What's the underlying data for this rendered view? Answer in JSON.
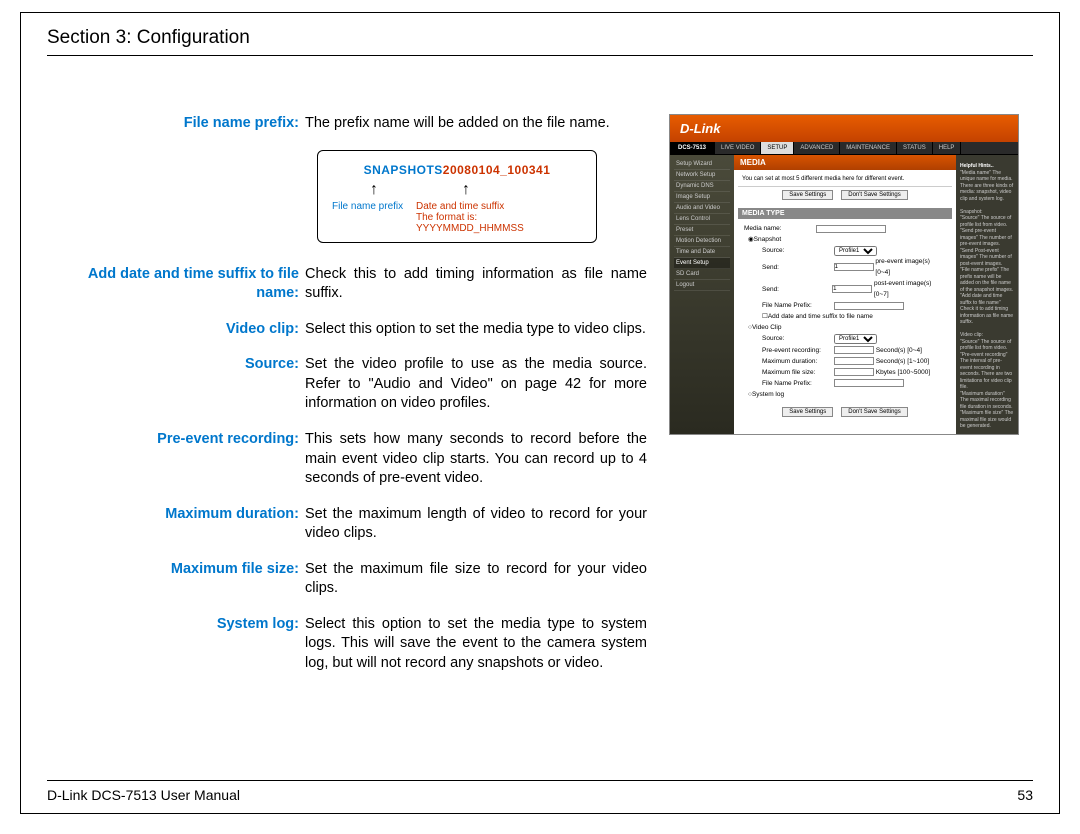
{
  "header": "Section 3: Configuration",
  "footer": {
    "left": "D-Link DCS-7513 User Manual",
    "right": "53"
  },
  "defs": {
    "file_name_prefix": {
      "term": "File name prefix:",
      "desc": "The prefix name will be added on the file name."
    },
    "add_datetime": {
      "term": "Add date and time suffix to file name:",
      "desc": "Check this to add timing information as file name suffix."
    },
    "video_clip": {
      "term": "Video clip:",
      "desc": "Select this option to set the media type to video clips."
    },
    "source": {
      "term": "Source:",
      "desc": "Set the video profile to use as the media source. Refer to \"Audio and Video\" on page 42 for more information on video profiles."
    },
    "pre_event": {
      "term": "Pre-event recording:",
      "desc": "This sets how many seconds to record before the main event video clip starts. You can record up to 4 seconds of pre-event video."
    },
    "max_duration": {
      "term": "Maximum duration:",
      "desc": "Set the maximum length of video to record for your video clips."
    },
    "max_filesize": {
      "term": "Maximum file size:",
      "desc": "Set the maximum file size to record for your video clips."
    },
    "system_log": {
      "term": "System log:",
      "desc": "Select this option to set the media type to system logs. This will save the event to the camera system log, but will not record any snapshots or video."
    }
  },
  "diagram": {
    "snapshots": "SNAPSHOTS",
    "datetime": "20080104_100341",
    "prefix_label": "File name prefix",
    "suffix_label": "Date and time suffix",
    "format": "The format is: YYYYMMDD_HHMMSS"
  },
  "mock": {
    "brand": "D-Link",
    "product": "DCS-7513",
    "tabs": [
      "LIVE VIDEO",
      "SETUP",
      "ADVANCED",
      "MAINTENANCE",
      "STATUS",
      "HELP"
    ],
    "side": [
      "Setup Wizard",
      "Network Setup",
      "Dynamic DNS",
      "Image Setup",
      "Audio and Video",
      "Lens Control",
      "Preset",
      "Motion Detection",
      "Time and Date",
      "Event Setup",
      "SD Card",
      "Logout"
    ],
    "title": "MEDIA",
    "note": "You can set at most 5 different media here for different event.",
    "btn_save": "Save Settings",
    "btn_dont": "Don't Save Settings",
    "panel": "MEDIA TYPE",
    "media_name": "Media name:",
    "opt_snapshot": "Snapshot",
    "lbl_source": "Source:",
    "val_profile": "Profile1",
    "lbl_send1": "Send:",
    "val_send1": "1",
    "hint_pre": "pre-event image(s) [0~4]",
    "lbl_send2": "Send:",
    "val_send2": "1",
    "hint_post": "post-event image(s) [0~7]",
    "lbl_prefix": "File Name Prefix:",
    "chk_datetime": "Add date and time suffix to file name",
    "opt_videoclip": "Video Clip",
    "lbl_prerec": "Pre-event recording:",
    "hint_prerec": "Second(s) [0~4]",
    "lbl_maxdur": "Maximum duration:",
    "hint_maxdur": "Second(s) [1~100]",
    "lbl_maxfs": "Maximum file size:",
    "hint_maxfs": "Kbytes [100~5000]",
    "lbl_prefix2": "File Name Prefix:",
    "opt_syslog": "System log",
    "hints_title": "Helpful Hints..",
    "hints_body": "\"Media name\" The unique name for media. There are three kinds of media: snapshot, video clip and system log.\n\nSnapshot:\n\"Source\" The source of profile list from video.\n\"Send pre-event images\" The number of pre-event images.\n\"Send Post-event images\" The number of post-event images.\n\"File name prefix\" The prefix name will be added on the file name of the snapshot images.\n\"Add date and time suffix to file name\" Check it to add timing information as file name suffix.\n\nVideo clip:\n\"Source\" The source of profile list from video.\n\"Pre-event recording\" The interval of pre-event recording in seconds. There are two limitations for video clip file.\n\"Maximum duration\" The maximal recording file duration in seconds.\n\"Maximum file size\" The maximal file size would be generated."
  }
}
